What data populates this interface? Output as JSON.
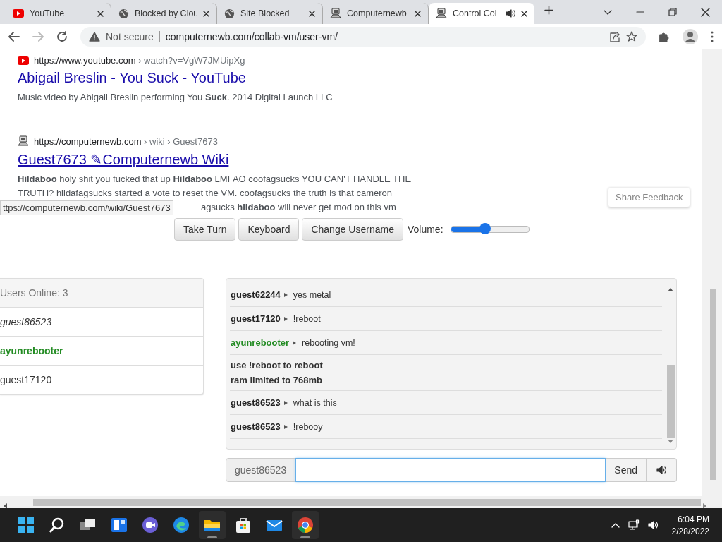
{
  "tabs": [
    {
      "title": "YouTube",
      "kind": "youtube",
      "selected": false,
      "audio": false
    },
    {
      "title": "Blocked by Clou",
      "kind": "globe",
      "selected": false,
      "audio": false
    },
    {
      "title": "Site Blocked",
      "kind": "globe",
      "selected": false,
      "audio": false
    },
    {
      "title": "Computernewb",
      "kind": "computer",
      "selected": false,
      "audio": false
    },
    {
      "title": "Control Col",
      "kind": "computer",
      "selected": true,
      "audio": true
    }
  ],
  "address_bar": {
    "security": "Not secure",
    "url": "computernewb.com/collab-vm/user-vm/"
  },
  "results": [
    {
      "kind": "youtube",
      "site": "https://www.youtube.com",
      "path": "› watch?v=VgW7JMUipXg",
      "title": "Abigail Breslin - You Suck - YouTube",
      "underlined": false,
      "snippet": [
        "Music video by Abigail Breslin performing You **Suck**. 2014 Digital Launch LLC"
      ]
    },
    {
      "kind": "computer",
      "site": "https://computernewb.com",
      "path": "› wiki › Guest7673",
      "title": "Guest7673 ✎Computernewb Wiki",
      "underlined": true,
      "snippet": [
        "**Hildaboo** holy shit you fucked that up **Hildaboo** LMFAO coofagsucks YOU CAN'T HANDLE THE",
        "TRUTH? hildafagsucks started a vote to reset the VM. coofagsucks the truth is that cameron",
        "agsucks **hildaboo** will never get mod on this vm"
      ]
    }
  ],
  "status_tooltip": "ttps://computernewb.com/wiki/Guest7673",
  "share_feedback": "Share Feedback",
  "controls": {
    "buttons": [
      "Take Turn",
      "Keyboard",
      "Change Username"
    ],
    "volume": {
      "label": "Volume:",
      "level": 0.44
    }
  },
  "users": {
    "header": "Users Online: 3",
    "items": [
      {
        "name": "guest86523",
        "kind": "self"
      },
      {
        "name": "ayunrebooter",
        "kind": "admin"
      },
      {
        "name": "guest17120",
        "kind": "normal"
      }
    ]
  },
  "chat": [
    {
      "kind": "message",
      "user": {
        "name": "guest62244",
        "kind": "normal"
      },
      "text": "yes metal"
    },
    {
      "kind": "message",
      "user": {
        "name": "guest17120",
        "kind": "normal"
      },
      "text": "!reboot"
    },
    {
      "kind": "message",
      "user": {
        "name": "ayunrebooter",
        "kind": "admin"
      },
      "text": "rebooting vm!"
    },
    {
      "kind": "notice",
      "lines": [
        "use !reboot to reboot",
        "ram limited to 768mb"
      ]
    },
    {
      "kind": "message",
      "user": {
        "name": "guest86523",
        "kind": "normal"
      },
      "text": "what is this"
    },
    {
      "kind": "message",
      "user": {
        "name": "guest86523",
        "kind": "normal"
      },
      "text": "!rebooy"
    }
  ],
  "chat_input": {
    "username": "guest86523",
    "send": "Send"
  },
  "taskbar": {
    "apps": [
      {
        "kind": "start",
        "active": false
      },
      {
        "kind": "search",
        "active": false
      },
      {
        "kind": "taskview",
        "active": false
      },
      {
        "kind": "widgets",
        "active": false
      },
      {
        "kind": "chat",
        "active": false
      },
      {
        "kind": "edge",
        "active": false
      },
      {
        "kind": "folder",
        "active": true
      },
      {
        "kind": "store",
        "active": false
      },
      {
        "kind": "mail",
        "active": false
      },
      {
        "kind": "chrome",
        "active": true
      }
    ],
    "time": "6:04 PM",
    "date": "2/28/2022"
  }
}
